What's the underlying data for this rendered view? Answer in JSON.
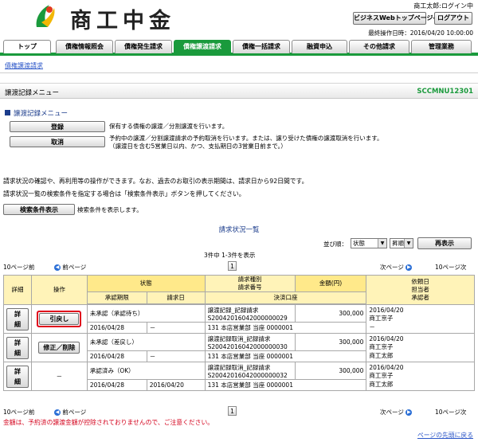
{
  "header": {
    "logo_text": "商工中金",
    "user_name": "商工太郎:ログイン中",
    "business_top_label": "ビジネスWebトップページへ",
    "logout_label": "ログアウト",
    "last_operation": "最終操作日時：2016/04/20 10:00:00"
  },
  "tabs": [
    {
      "label": "トップ"
    },
    {
      "label": "債権情報照会"
    },
    {
      "label": "債権発生請求"
    },
    {
      "label": "債権譲渡請求"
    },
    {
      "label": "債権一括請求"
    },
    {
      "label": "融資申込"
    },
    {
      "label": "その他請求"
    },
    {
      "label": "管理業務"
    }
  ],
  "breadcrumb": "債権譲渡請求",
  "screen": {
    "title": "譲渡記録メニュー",
    "code": "SCCMNU12301"
  },
  "menu": {
    "section_title": "譲渡記録メニュー",
    "register_label": "登録",
    "register_desc": "保有する債権の譲渡／分割譲渡を行います。",
    "cancel_label": "取消",
    "cancel_desc_1": "予約中の譲渡／分割譲渡請求の予約取消を行います。または、譲り受けた債権の譲渡取消を行います。",
    "cancel_desc_2": "（譲渡日を含む5営業日以内、かつ、支払期日の3営業日前まで。）"
  },
  "info": {
    "line1": "請求状況の確認や、再利用等の操作ができます。なお、過去のお取引の表示期間は、請求日から92日間です。",
    "line2": "請求状況一覧の検索条件を指定する場合は「検索条件表示」ボタンを押してください。",
    "search_button": "検索条件表示",
    "search_desc": "検索条件を表示します。"
  },
  "list": {
    "title": "請求状況一覧",
    "sort_label": "並び順：",
    "sort_field": "状態",
    "sort_order": "昇順",
    "resort_button": "再表示",
    "count_text": "3件中 1-3件を表示",
    "prev10": "10ページ前",
    "prev_page": "前ページ",
    "page_number": "1",
    "next_page": "次ページ",
    "next10": "10ページ次"
  },
  "table": {
    "headers": {
      "detail": "詳細",
      "operation": "操作",
      "status": "状態",
      "req_type_line1": "請求種別",
      "req_type_line2": "請求番号",
      "amount": "金額(円)",
      "requester_line1": "依頼日",
      "requester_line2": "担当者",
      "requester_line3": "承認者",
      "approval_deadline": "承認期限",
      "request_date": "請求日",
      "settlement_account": "決済口座"
    },
    "rows": [
      {
        "detail_label": "詳細",
        "operation_label": "引戻し",
        "status": "未承認（承認待ち）",
        "deadline": "2016/04/28",
        "request_date": "－",
        "req_type": "譲渡記録_記録請求",
        "req_no": "S20042016042000000029",
        "account": "131 本店営業部 当座 0000001",
        "amount": "300,000",
        "req_date": "2016/04/20",
        "staff": "商工京子",
        "approver": "－"
      },
      {
        "detail_label": "詳細",
        "operation_label": "修正／削除",
        "status": "未承認（差戻し）",
        "deadline": "2016/04/28",
        "request_date": "－",
        "req_type": "譲渡記録取消_記録請求",
        "req_no": "S20042016042000000030",
        "account": "131 本店営業部 当座 0000001",
        "amount": "300,000",
        "req_date": "2016/04/20",
        "staff": "商工京子",
        "approver": "商工太郎"
      },
      {
        "detail_label": "詳細",
        "operation_label": "－",
        "status": "承認済み（OK）",
        "deadline": "2016/04/28",
        "request_date": "2016/04/20",
        "req_type": "譲渡記録取消_記録請求",
        "req_no": "S20042016042000000032",
        "account": "131 本店営業部 当座 0000001",
        "amount": "300,000",
        "req_date": "2016/04/20",
        "staff": "商工京子",
        "approver": "商工太郎"
      }
    ]
  },
  "footer": {
    "note": "金額は、予約済の譲渡金額が控除されておりませんので、ご注意ください。",
    "top_link": "ページの先頭に戻る"
  },
  "colors": {
    "brand_green": "#1a9a3c",
    "header_yellow": "#fff3b8",
    "highlight_red": "#e0001b",
    "link_blue": "#2b56c8"
  }
}
